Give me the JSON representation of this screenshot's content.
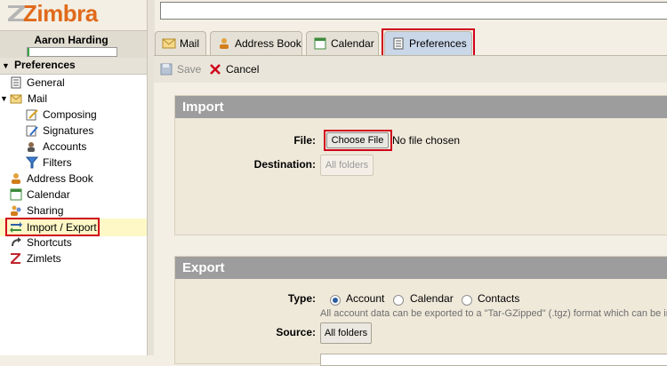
{
  "app": {
    "brand": "Zimbra"
  },
  "user": {
    "name": "Aaron Harding",
    "quota_fraction": 0.02
  },
  "sidebar": {
    "header": "Preferences",
    "items": [
      {
        "label": "General",
        "icon": "general-doc-icon"
      },
      {
        "label": "Mail",
        "icon": "mail-envelope-icon"
      },
      {
        "label": "Composing",
        "icon": "composing-pencil-icon"
      },
      {
        "label": "Signatures",
        "icon": "signature-pen-icon"
      },
      {
        "label": "Accounts",
        "icon": "accounts-person-icon"
      },
      {
        "label": "Filters",
        "icon": "filters-funnel-icon"
      },
      {
        "label": "Address Book",
        "icon": "address-book-person-icon"
      },
      {
        "label": "Calendar",
        "icon": "calendar-icon"
      },
      {
        "label": "Sharing",
        "icon": "sharing-people-icon"
      },
      {
        "label": "Import / Export",
        "icon": "import-export-arrows-icon"
      },
      {
        "label": "Shortcuts",
        "icon": "shortcut-arrow-icon"
      },
      {
        "label": "Zimlets",
        "icon": "zimlets-z-icon"
      }
    ],
    "selected_index": 9
  },
  "tabs": [
    {
      "label": "Mail",
      "icon": "mail-envelope-icon"
    },
    {
      "label": "Address Book",
      "icon": "address-book-person-icon"
    },
    {
      "label": "Calendar",
      "icon": "calendar-icon"
    },
    {
      "label": "Preferences",
      "icon": "preferences-list-icon"
    }
  ],
  "active_tab": "Preferences",
  "toolbar": {
    "save_label": "Save",
    "cancel_label": "Cancel"
  },
  "import": {
    "title": "Import",
    "file_label": "File:",
    "choose_file_label": "Choose File",
    "file_status": "No file chosen",
    "destination_label": "Destination:",
    "destination_value": "All folders"
  },
  "export": {
    "title": "Export",
    "type_label": "Type:",
    "type_options": [
      "Account",
      "Calendar",
      "Contacts"
    ],
    "type_selected": "Account",
    "note": "All account data can be exported to a \"Tar-GZipped\" (.tgz) format which can be im",
    "source_label": "Source:",
    "source_value": "All folders"
  },
  "colors": {
    "brand_orange": "#e06a1b",
    "highlight_red": "#d0021b",
    "section_header_gray": "#9d9d9d",
    "selected_row_yellow": "#fdf8c6",
    "active_tab_blue": "#c9d7e9"
  }
}
